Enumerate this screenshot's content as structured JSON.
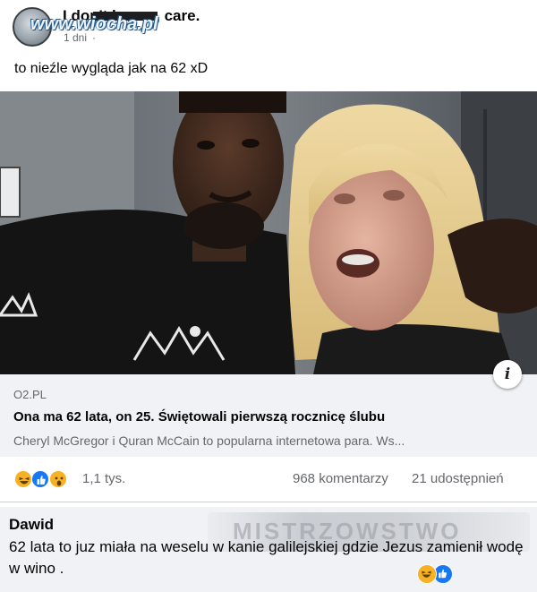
{
  "post": {
    "author": "I don't kurwa, care.",
    "timestamp": "1 dni",
    "separator": "·",
    "text": "to nieźle wygląda jak na 62 xD",
    "watermark": "www.wiocha.pl"
  },
  "link_card": {
    "domain": "O2.PL",
    "title": "Ona ma 62 lata, on 25. Świętowali pierwszą rocznicę ślubu",
    "description": "Cheryl McGregor i Quran McCain to popularna internetowa para. Ws...",
    "info_glyph": "i"
  },
  "engagement": {
    "reaction_icons": [
      "haha-icon",
      "like-icon",
      "wow-icon"
    ],
    "reaction_count": "1,1 tys.",
    "comments": "968 komentarzy",
    "shares": "21 udostępnień"
  },
  "comment": {
    "author": "Dawid",
    "text": "62 lata to juz miała na weselu w kanie galilejskiej gdzie Jezus zamienił wodę w wino .",
    "blurred_caption": "MISTRZOWSTWO",
    "reaction_icons": [
      "haha-icon",
      "like-icon"
    ]
  },
  "colors": {
    "facebook_blue": "#1877f2",
    "reaction_yellow": "#f7b125",
    "secondary_text": "#65676b",
    "card_background": "#f0f2f5"
  }
}
